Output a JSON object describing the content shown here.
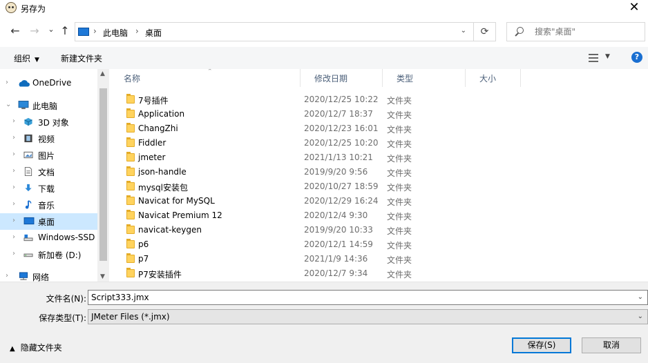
{
  "window": {
    "title": "另存为",
    "close_glyph": "✕"
  },
  "navigation": {
    "back_glyph": "←",
    "forward_glyph": "→",
    "recent_glyph": "⌄",
    "up_glyph": "↑",
    "breadcrumbs": [
      "此电脑",
      "桌面"
    ],
    "crumb_separator": "›",
    "dropdown_glyph": "⌄",
    "refresh_glyph": "⟳",
    "search_placeholder": "搜索\"桌面\""
  },
  "toolbar": {
    "organize_label": "组织",
    "new_folder_label": "新建文件夹",
    "help_glyph": "?",
    "caret": "▼"
  },
  "nav_pane": {
    "items": [
      {
        "label": "OneDrive",
        "icon": "onedrive-icon",
        "selected": false
      },
      {
        "label": "此电脑",
        "icon": "pc-icon",
        "selected": false
      },
      {
        "label": "3D 对象",
        "icon": "3d-objects-icon",
        "selected": false
      },
      {
        "label": "视频",
        "icon": "video-icon",
        "selected": false
      },
      {
        "label": "图片",
        "icon": "pictures-icon",
        "selected": false
      },
      {
        "label": "文档",
        "icon": "documents-icon",
        "selected": false
      },
      {
        "label": "下载",
        "icon": "download-icon",
        "selected": false
      },
      {
        "label": "音乐",
        "icon": "music-icon",
        "selected": false
      },
      {
        "label": "桌面",
        "icon": "desktop-icon",
        "selected": true
      },
      {
        "label": "Windows-SSD",
        "icon": "drive-icon",
        "selected": false
      },
      {
        "label": "新加卷 (D:)",
        "icon": "drive-icon",
        "selected": false
      },
      {
        "label": "网络",
        "icon": "network-icon",
        "selected": false
      }
    ]
  },
  "file_list": {
    "columns": [
      "名称",
      "修改日期",
      "类型",
      "大小"
    ],
    "rows": [
      {
        "name": "7号插件",
        "date": "2020/12/25 10:22",
        "type": "文件夹"
      },
      {
        "name": "Application",
        "date": "2020/12/7 18:37",
        "type": "文件夹"
      },
      {
        "name": "ChangZhi",
        "date": "2020/12/23 16:01",
        "type": "文件夹"
      },
      {
        "name": "Fiddler",
        "date": "2020/12/25 10:20",
        "type": "文件夹"
      },
      {
        "name": "jmeter",
        "date": "2021/1/13 10:21",
        "type": "文件夹"
      },
      {
        "name": "json-handle",
        "date": "2019/9/20 9:56",
        "type": "文件夹"
      },
      {
        "name": "mysql安装包",
        "date": "2020/10/27 18:59",
        "type": "文件夹"
      },
      {
        "name": "Navicat for MySQL",
        "date": "2020/12/29 16:24",
        "type": "文件夹"
      },
      {
        "name": "Navicat Premium 12",
        "date": "2020/12/4 9:30",
        "type": "文件夹"
      },
      {
        "name": "navicat-keygen",
        "date": "2019/9/20 10:33",
        "type": "文件夹"
      },
      {
        "name": "p6",
        "date": "2020/12/1 14:59",
        "type": "文件夹"
      },
      {
        "name": "p7",
        "date": "2021/1/9 14:36",
        "type": "文件夹"
      },
      {
        "name": "P7安装插件",
        "date": "2020/12/7 9:34",
        "type": "文件夹"
      }
    ]
  },
  "save_form": {
    "filename_label": "文件名(N):",
    "filename_value": "Script333.jmx",
    "filetype_label": "保存类型(T):",
    "filetype_value": "JMeter Files (*.jmx)",
    "hide_folders_label": "隐藏文件夹",
    "save_label": "保存(S)",
    "cancel_label": "取消"
  }
}
